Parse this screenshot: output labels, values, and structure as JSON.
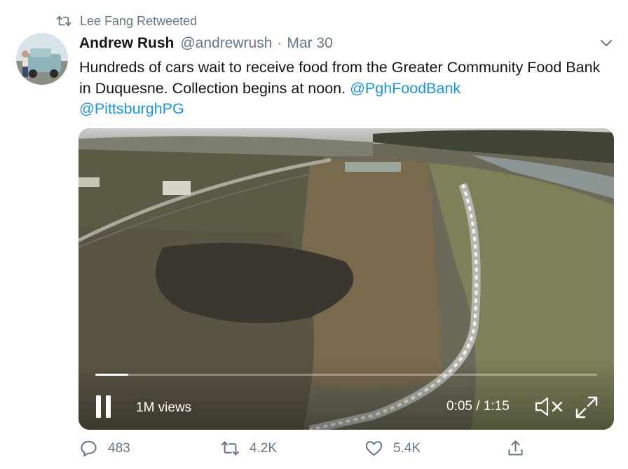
{
  "retweet": {
    "text": "Lee Fang Retweeted",
    "icon": "retweet-icon"
  },
  "tweet": {
    "author_name": "Andrew Rush",
    "author_handle": "@andrewrush",
    "separator": "·",
    "date": "Mar 30",
    "text_before": "Hundreds of cars wait to receive food from the Greater Community Food Bank in Duquesne. Collection begins at noon. ",
    "mention_1": "@PghFoodBank",
    "mention_2": "@PittsburghPG"
  },
  "video": {
    "views": "1M views",
    "time": "0:05 / 1:15",
    "progress": 0.065,
    "muted": true
  },
  "actions": {
    "replies": "483",
    "retweets": "4.2K",
    "likes": "5.4K"
  },
  "colors": {
    "link": "#1b95e0",
    "muted_text": "#657786",
    "text": "#14171a"
  }
}
